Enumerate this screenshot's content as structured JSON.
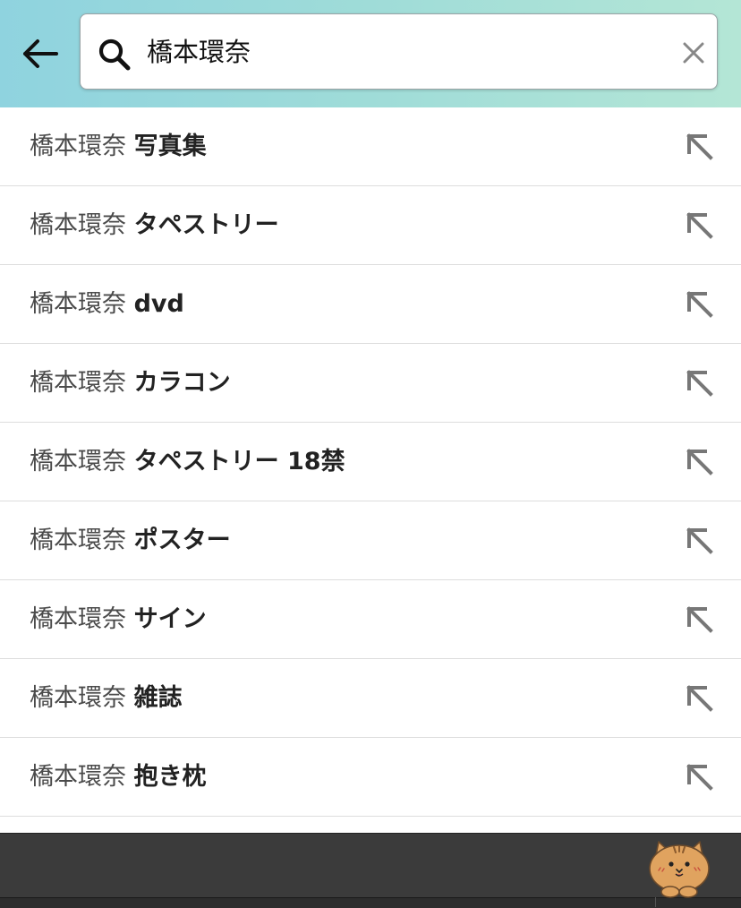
{
  "search": {
    "query": "橋本環奈",
    "query_prefix": "橋本環奈"
  },
  "suggestions": [
    {
      "prefix": "橋本環奈",
      "suffix": "写真集"
    },
    {
      "prefix": "橋本環奈",
      "suffix": "タペストリー"
    },
    {
      "prefix": "橋本環奈",
      "suffix": "dvd"
    },
    {
      "prefix": "橋本環奈",
      "suffix": "カラコン"
    },
    {
      "prefix": "橋本環奈",
      "suffix": "タペストリー 18禁"
    },
    {
      "prefix": "橋本環奈",
      "suffix": "ポスター"
    },
    {
      "prefix": "橋本環奈",
      "suffix": "サイン"
    },
    {
      "prefix": "橋本環奈",
      "suffix": "雑誌"
    },
    {
      "prefix": "橋本環奈",
      "suffix": "抱き枕"
    }
  ],
  "icons": {
    "back": "arrow-left-icon",
    "search": "magnifier-icon",
    "clear": "close-icon",
    "fill_suggestion": "arrow-up-left-icon",
    "mascot": "cat-mascot-icon"
  },
  "colors": {
    "header_gradient_start": "#8fd3df",
    "header_gradient_end": "#b4e6d6",
    "bottom_bar": "#3b3b3b",
    "mascot_fur": "#e0a35f"
  }
}
